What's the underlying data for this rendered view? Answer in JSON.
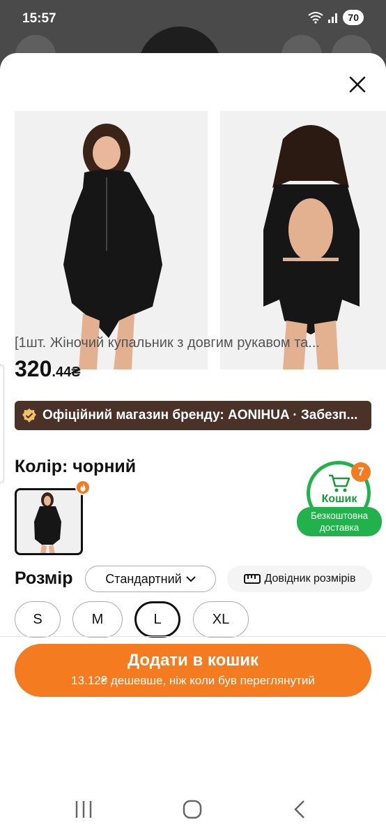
{
  "status_bar": {
    "time": "15:57",
    "battery": "70"
  },
  "sheet": {
    "close_icon": "close-icon",
    "product_title": "[1шт. Жіночий купальник з довгим рукавом та...",
    "price_main": "320",
    "price_fraction": ".44₴",
    "store_banner": "Офіційний магазин бренду: AONIHUA · Забезп...",
    "color_label": "Колір: чорний",
    "cart": {
      "label": "Кошик",
      "count": "7",
      "shipping": "Безкоштовна доставка"
    },
    "size_label": "Розмір",
    "size_standard": "Стандартний",
    "size_guide": "Довідник розмірів",
    "sizes": [
      "S",
      "M",
      "L",
      "XL"
    ],
    "selected_size": "L",
    "add_to_cart": {
      "label": "Додати в кошик",
      "subtext": "13.12₴ дешевше, ніж коли був переглянутий"
    }
  },
  "colors": {
    "accent": "#f47b20",
    "cart_green": "#21b24b",
    "banner_brown": "#4b3228"
  }
}
